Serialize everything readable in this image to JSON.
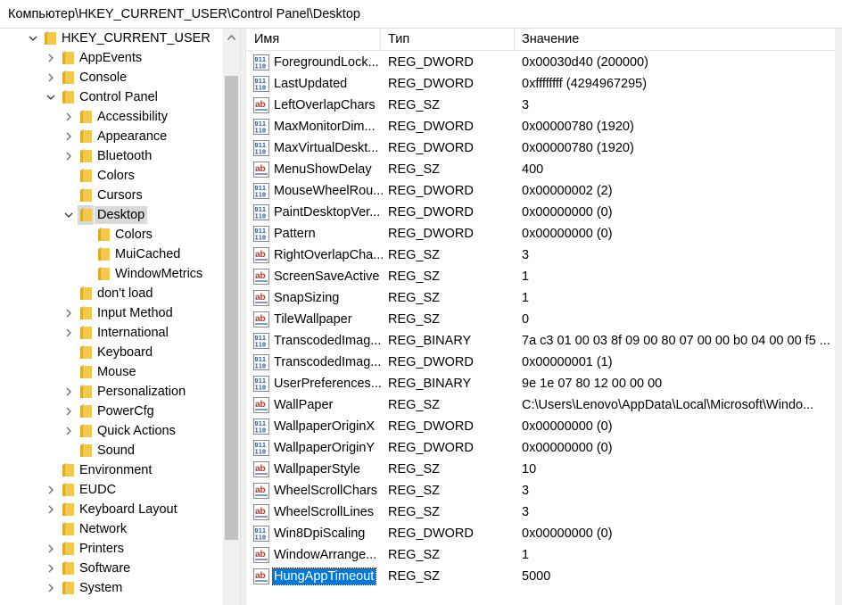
{
  "address": "Компьютер\\HKEY_CURRENT_USER\\Control Panel\\Desktop",
  "columns": {
    "name": "Имя",
    "type": "Тип",
    "data": "Значение"
  },
  "tree": [
    {
      "label": "HKEY_CURRENT_USER",
      "depth": 0,
      "state": "open"
    },
    {
      "label": "AppEvents",
      "depth": 1,
      "state": "closed"
    },
    {
      "label": "Console",
      "depth": 1,
      "state": "closed"
    },
    {
      "label": "Control Panel",
      "depth": 1,
      "state": "open"
    },
    {
      "label": "Accessibility",
      "depth": 2,
      "state": "closed"
    },
    {
      "label": "Appearance",
      "depth": 2,
      "state": "closed"
    },
    {
      "label": "Bluetooth",
      "depth": 2,
      "state": "closed"
    },
    {
      "label": "Colors",
      "depth": 2,
      "state": "none"
    },
    {
      "label": "Cursors",
      "depth": 2,
      "state": "none"
    },
    {
      "label": "Desktop",
      "depth": 2,
      "state": "open",
      "selected": true
    },
    {
      "label": "Colors",
      "depth": 3,
      "state": "none"
    },
    {
      "label": "MuiCached",
      "depth": 3,
      "state": "none"
    },
    {
      "label": "WindowMetrics",
      "depth": 3,
      "state": "none"
    },
    {
      "label": "don't load",
      "depth": 2,
      "state": "none"
    },
    {
      "label": "Input Method",
      "depth": 2,
      "state": "closed"
    },
    {
      "label": "International",
      "depth": 2,
      "state": "closed"
    },
    {
      "label": "Keyboard",
      "depth": 2,
      "state": "none"
    },
    {
      "label": "Mouse",
      "depth": 2,
      "state": "none"
    },
    {
      "label": "Personalization",
      "depth": 2,
      "state": "closed"
    },
    {
      "label": "PowerCfg",
      "depth": 2,
      "state": "closed"
    },
    {
      "label": "Quick Actions",
      "depth": 2,
      "state": "closed"
    },
    {
      "label": "Sound",
      "depth": 2,
      "state": "none"
    },
    {
      "label": "Environment",
      "depth": 1,
      "state": "none"
    },
    {
      "label": "EUDC",
      "depth": 1,
      "state": "closed"
    },
    {
      "label": "Keyboard Layout",
      "depth": 1,
      "state": "closed"
    },
    {
      "label": "Network",
      "depth": 1,
      "state": "none"
    },
    {
      "label": "Printers",
      "depth": 1,
      "state": "closed"
    },
    {
      "label": "Software",
      "depth": 1,
      "state": "closed"
    },
    {
      "label": "System",
      "depth": 1,
      "state": "closed"
    }
  ],
  "values": [
    {
      "name": "ForegroundLock...",
      "type": "REG_DWORD",
      "data": "0x00030d40 (200000)",
      "icon": "bin"
    },
    {
      "name": "LastUpdated",
      "type": "REG_DWORD",
      "data": "0xffffffff (4294967295)",
      "icon": "bin"
    },
    {
      "name": "LeftOverlapChars",
      "type": "REG_SZ",
      "data": "3",
      "icon": "ab"
    },
    {
      "name": "MaxMonitorDim...",
      "type": "REG_DWORD",
      "data": "0x00000780 (1920)",
      "icon": "bin"
    },
    {
      "name": "MaxVirtualDeskt...",
      "type": "REG_DWORD",
      "data": "0x00000780 (1920)",
      "icon": "bin"
    },
    {
      "name": "MenuShowDelay",
      "type": "REG_SZ",
      "data": "400",
      "icon": "ab"
    },
    {
      "name": "MouseWheelRou...",
      "type": "REG_DWORD",
      "data": "0x00000002 (2)",
      "icon": "bin"
    },
    {
      "name": "PaintDesktopVer...",
      "type": "REG_DWORD",
      "data": "0x00000000 (0)",
      "icon": "bin"
    },
    {
      "name": "Pattern",
      "type": "REG_DWORD",
      "data": "0x00000000 (0)",
      "icon": "bin"
    },
    {
      "name": "RightOverlapCha...",
      "type": "REG_SZ",
      "data": "3",
      "icon": "ab"
    },
    {
      "name": "ScreenSaveActive",
      "type": "REG_SZ",
      "data": "1",
      "icon": "ab"
    },
    {
      "name": "SnapSizing",
      "type": "REG_SZ",
      "data": "1",
      "icon": "ab"
    },
    {
      "name": "TileWallpaper",
      "type": "REG_SZ",
      "data": "0",
      "icon": "ab"
    },
    {
      "name": "TranscodedImag...",
      "type": "REG_BINARY",
      "data": "7a c3 01 00 03 8f 09 00 80 07 00 00 b0 04 00 00 f5 ...",
      "icon": "bin"
    },
    {
      "name": "TranscodedImag...",
      "type": "REG_DWORD",
      "data": "0x00000001 (1)",
      "icon": "bin"
    },
    {
      "name": "UserPreferences...",
      "type": "REG_BINARY",
      "data": "9e 1e 07 80 12 00 00 00",
      "icon": "bin"
    },
    {
      "name": "WallPaper",
      "type": "REG_SZ",
      "data": "C:\\Users\\Lenovo\\AppData\\Local\\Microsoft\\Windo...",
      "icon": "ab"
    },
    {
      "name": "WallpaperOriginX",
      "type": "REG_DWORD",
      "data": "0x00000000 (0)",
      "icon": "bin"
    },
    {
      "name": "WallpaperOriginY",
      "type": "REG_DWORD",
      "data": "0x00000000 (0)",
      "icon": "bin"
    },
    {
      "name": "WallpaperStyle",
      "type": "REG_SZ",
      "data": "10",
      "icon": "ab"
    },
    {
      "name": "WheelScrollChars",
      "type": "REG_SZ",
      "data": "3",
      "icon": "ab"
    },
    {
      "name": "WheelScrollLines",
      "type": "REG_SZ",
      "data": "3",
      "icon": "ab"
    },
    {
      "name": "Win8DpiScaling",
      "type": "REG_DWORD",
      "data": "0x00000000 (0)",
      "icon": "bin"
    },
    {
      "name": "WindowArrange...",
      "type": "REG_SZ",
      "data": "1",
      "icon": "ab"
    },
    {
      "name": "HungAppTimeout",
      "type": "REG_SZ",
      "data": "5000",
      "icon": "ab",
      "selected": true
    }
  ],
  "colors": {
    "folder": "#f2c94c",
    "folder_dark": "#dcab2a",
    "selection": "#0078d7",
    "tree_selection": "#d9d9d9",
    "ab_red": "#c0392b",
    "bin_blue": "#2b57a3"
  }
}
